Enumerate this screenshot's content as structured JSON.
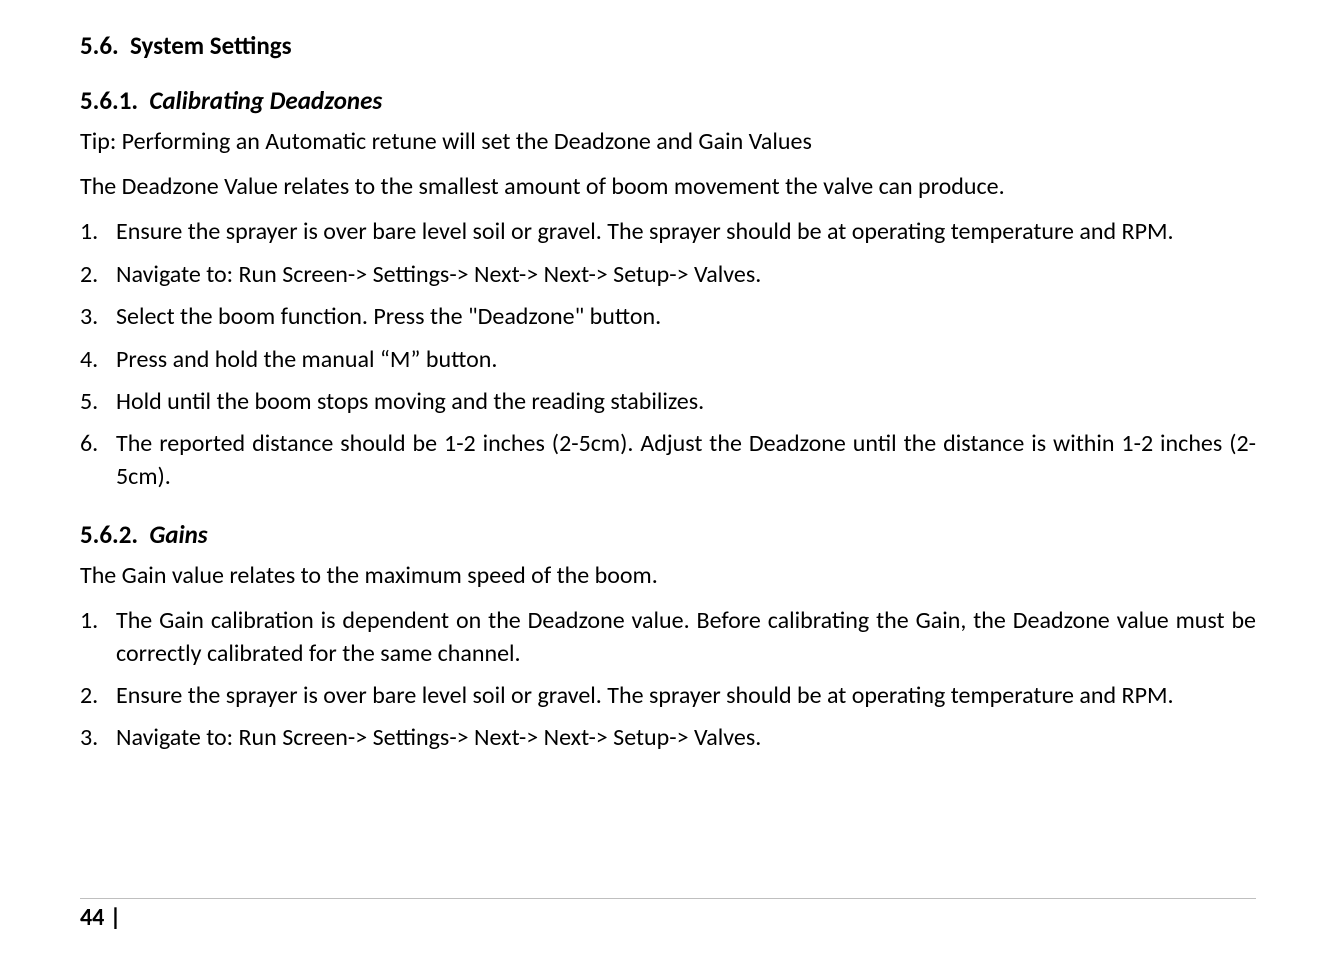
{
  "section": {
    "number": "5.6.",
    "title": "System Settings"
  },
  "sub1": {
    "number": "5.6.1.",
    "title": "Calibrating Deadzones",
    "tip": "Tip: Performing an Automatic retune will set the Deadzone and Gain Values",
    "intro": "The Deadzone Value relates to the smallest amount of boom movement the valve can produce.",
    "list": [
      "Ensure the sprayer is over bare level soil or gravel.  The sprayer should be at operating temperature and RPM.",
      "Navigate to: Run Screen-> Settings-> Next-> Next-> Setup-> Valves.",
      "Select the boom function.  Press the \"Deadzone\" button.",
      "Press and hold the manual “M” button.",
      "Hold until the boom stops moving and the reading stabilizes.",
      "The reported distance should be 1-2 inches (2-5cm).   Adjust the Deadzone until the distance is within 1-2 inches (2-5cm)."
    ]
  },
  "sub2": {
    "number": "5.6.2.",
    "title": "Gains",
    "intro": "The Gain value relates to the maximum speed of the boom.",
    "list": [
      "The Gain calibration is dependent on the Deadzone value.  Before calibrating the Gain, the Deadzone value must be correctly calibrated for the same channel.",
      "Ensure the sprayer is over bare level soil or gravel.  The sprayer should be at operating temperature and RPM.",
      "Navigate to: Run Screen-> Settings-> Next-> Next-> Setup-> Valves."
    ]
  },
  "footer": {
    "page": "44 |"
  }
}
